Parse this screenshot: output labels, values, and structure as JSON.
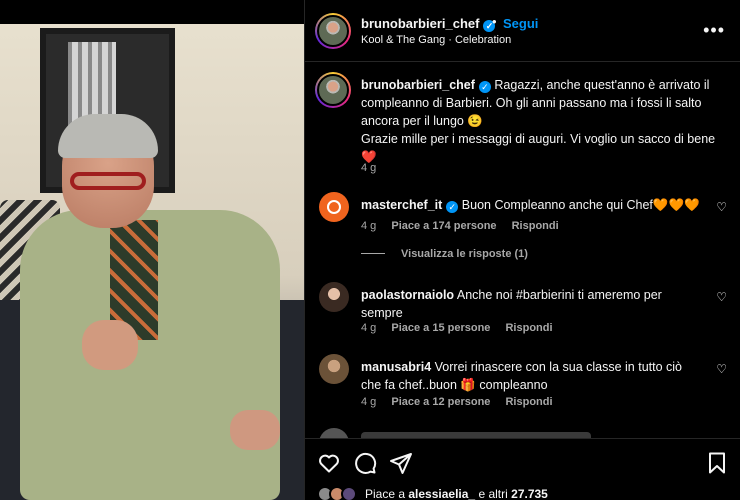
{
  "post": {
    "username": "brunobarbieri_chef",
    "dot": "•",
    "follow_label": "Segui",
    "music": "Kool & The Gang · Celebration",
    "more_label": "•••"
  },
  "caption": {
    "username": "brunobarbieri_chef",
    "text": "Ragazzi, anche quest'anno è arrivato il compleanno di Barbieri. Oh gli anni passano ma i fossi li salto ancora per il lungo 😉",
    "text2": "Grazie mille per i messaggi di auguri. Vi voglio un sacco di bene ❤️",
    "time": "4 g"
  },
  "comments": [
    {
      "username": "masterchef_it",
      "text": "Buon Compleanno anche qui Chef🧡🧡🧡",
      "time": "4 g",
      "likes": "Piace a 174 persone",
      "reply": "Rispondi",
      "view_replies": "Visualizza le risposte (1)"
    },
    {
      "username": "paolastornaiolo",
      "text": "Anche noi #barbierini ti ameremo per sempre",
      "time": "4 g",
      "likes": "Piace a 15 persone",
      "reply": "Rispondi"
    },
    {
      "username": "manusabri4",
      "text": "Vorrei rinascere con la sua classe in tutto ciò che fa chef..buon 🎁 compleanno",
      "time": "4 g",
      "likes": "Piace a 12 persone",
      "reply": "Rispondi"
    }
  ],
  "likes_summary": {
    "prefix": "Piace a",
    "user": "alessiaelia_",
    "suffix": "e altri",
    "count": "27.735"
  },
  "icons": {
    "heart": "heart-icon",
    "comment": "comment-icon",
    "share": "share-icon",
    "save": "bookmark-icon",
    "verified": "verified-badge-icon"
  },
  "colors": {
    "link_blue": "#0095f6",
    "muted": "#a8a8a8",
    "background": "#000000"
  }
}
